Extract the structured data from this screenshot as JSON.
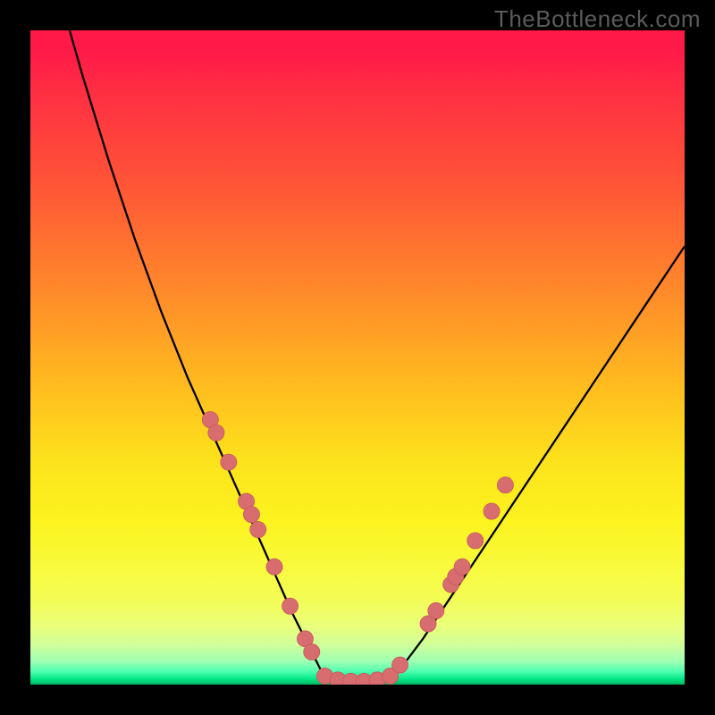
{
  "watermark": "TheBottleneck.com",
  "chart_data": {
    "type": "line",
    "title": "",
    "xlabel": "",
    "ylabel": "",
    "xlim": [
      0,
      100
    ],
    "ylim": [
      0,
      100
    ],
    "series": [
      {
        "name": "left-curve",
        "x": [
          6,
          8,
          10,
          12,
          14,
          16,
          18,
          20,
          22,
          24,
          26,
          28,
          30,
          32,
          34,
          36,
          38,
          40,
          42,
          44,
          45
        ],
        "y": [
          100,
          93,
          86.5,
          80,
          74,
          68,
          62.5,
          57,
          52,
          47,
          42.5,
          38,
          33.5,
          29,
          24.5,
          20,
          15.5,
          11,
          7,
          3,
          1
        ]
      },
      {
        "name": "flat-valley",
        "x": [
          45,
          46,
          48,
          50,
          52,
          54,
          55
        ],
        "y": [
          1,
          0.6,
          0.3,
          0.2,
          0.3,
          0.6,
          1
        ]
      },
      {
        "name": "right-curve",
        "x": [
          55,
          57,
          60,
          63,
          66,
          70,
          74,
          78,
          82,
          86,
          90,
          94,
          98,
          100
        ],
        "y": [
          1,
          3,
          7,
          11.5,
          16,
          22,
          28,
          34,
          40,
          46,
          52,
          58,
          64,
          67
        ]
      }
    ],
    "markers": {
      "name": "dot-cluster",
      "color": "#d86d70",
      "radius": 9,
      "points": [
        {
          "x": 27.5,
          "y": 40.5
        },
        {
          "x": 28.4,
          "y": 38.5
        },
        {
          "x": 30.3,
          "y": 34
        },
        {
          "x": 33.0,
          "y": 28
        },
        {
          "x": 33.8,
          "y": 26
        },
        {
          "x": 34.8,
          "y": 23.7
        },
        {
          "x": 37.3,
          "y": 18
        },
        {
          "x": 39.7,
          "y": 12
        },
        {
          "x": 42.0,
          "y": 7
        },
        {
          "x": 43.0,
          "y": 5
        },
        {
          "x": 45.0,
          "y": 1.3
        },
        {
          "x": 47.0,
          "y": 0.7
        },
        {
          "x": 49.0,
          "y": 0.5
        },
        {
          "x": 51.0,
          "y": 0.5
        },
        {
          "x": 53.0,
          "y": 0.7
        },
        {
          "x": 55.0,
          "y": 1.3
        },
        {
          "x": 56.5,
          "y": 3
        },
        {
          "x": 60.8,
          "y": 9.3
        },
        {
          "x": 62.0,
          "y": 11.3
        },
        {
          "x": 64.3,
          "y": 15.3
        },
        {
          "x": 65.0,
          "y": 16.5
        },
        {
          "x": 66.0,
          "y": 18
        },
        {
          "x": 68.0,
          "y": 22
        },
        {
          "x": 70.5,
          "y": 26.5
        },
        {
          "x": 72.6,
          "y": 30.5
        }
      ]
    },
    "theme": {
      "line_color": "#000000",
      "line_width": 2.3,
      "marker_stroke": "#c95a5e"
    }
  }
}
